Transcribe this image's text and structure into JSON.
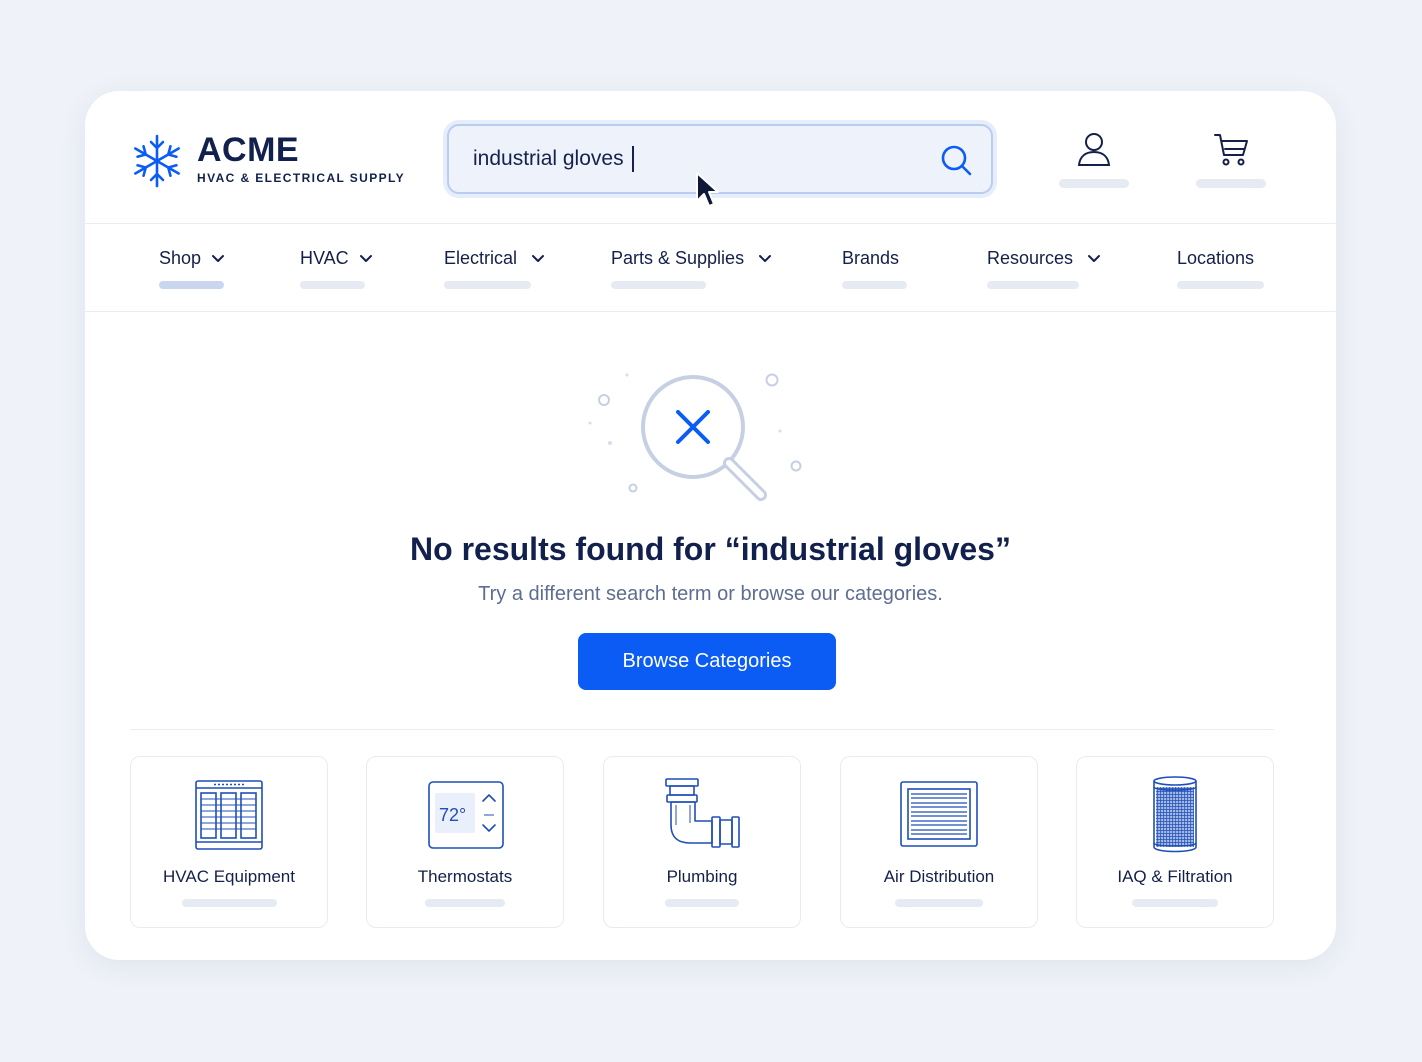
{
  "brand": {
    "name": "ACME",
    "tagline": "HVAC & ELECTRICAL SUPPLY",
    "accent": "#0a5cf5",
    "dark": "#12204d"
  },
  "search": {
    "value": "industrial gloves",
    "placeholder": ""
  },
  "header_icons": [
    "user-icon",
    "cart-icon"
  ],
  "nav": {
    "items": [
      {
        "label": "Shop",
        "dropdown": true,
        "active": true
      },
      {
        "label": "HVAC",
        "dropdown": true,
        "active": false
      },
      {
        "label": "Electrical",
        "dropdown": true,
        "active": false
      },
      {
        "label": "Parts & Supplies",
        "dropdown": true,
        "active": false
      },
      {
        "label": "Brands",
        "dropdown": false,
        "active": false
      },
      {
        "label": "Resources",
        "dropdown": true,
        "active": false
      },
      {
        "label": "Locations",
        "dropdown": false,
        "active": false
      }
    ]
  },
  "empty_state": {
    "headline": "No results found for “industrial gloves”",
    "subline": "Try a different search term or browse our categories.",
    "button": "Browse Categories"
  },
  "categories": [
    {
      "label": "HVAC Equipment",
      "icon": "hvac-unit-icon"
    },
    {
      "label": "Thermostats",
      "icon": "thermostat-icon",
      "reading": "72°"
    },
    {
      "label": "Plumbing",
      "icon": "pipe-icon"
    },
    {
      "label": "Air Distribution",
      "icon": "vent-icon"
    },
    {
      "label": "IAQ & Filtration",
      "icon": "filter-icon"
    }
  ]
}
